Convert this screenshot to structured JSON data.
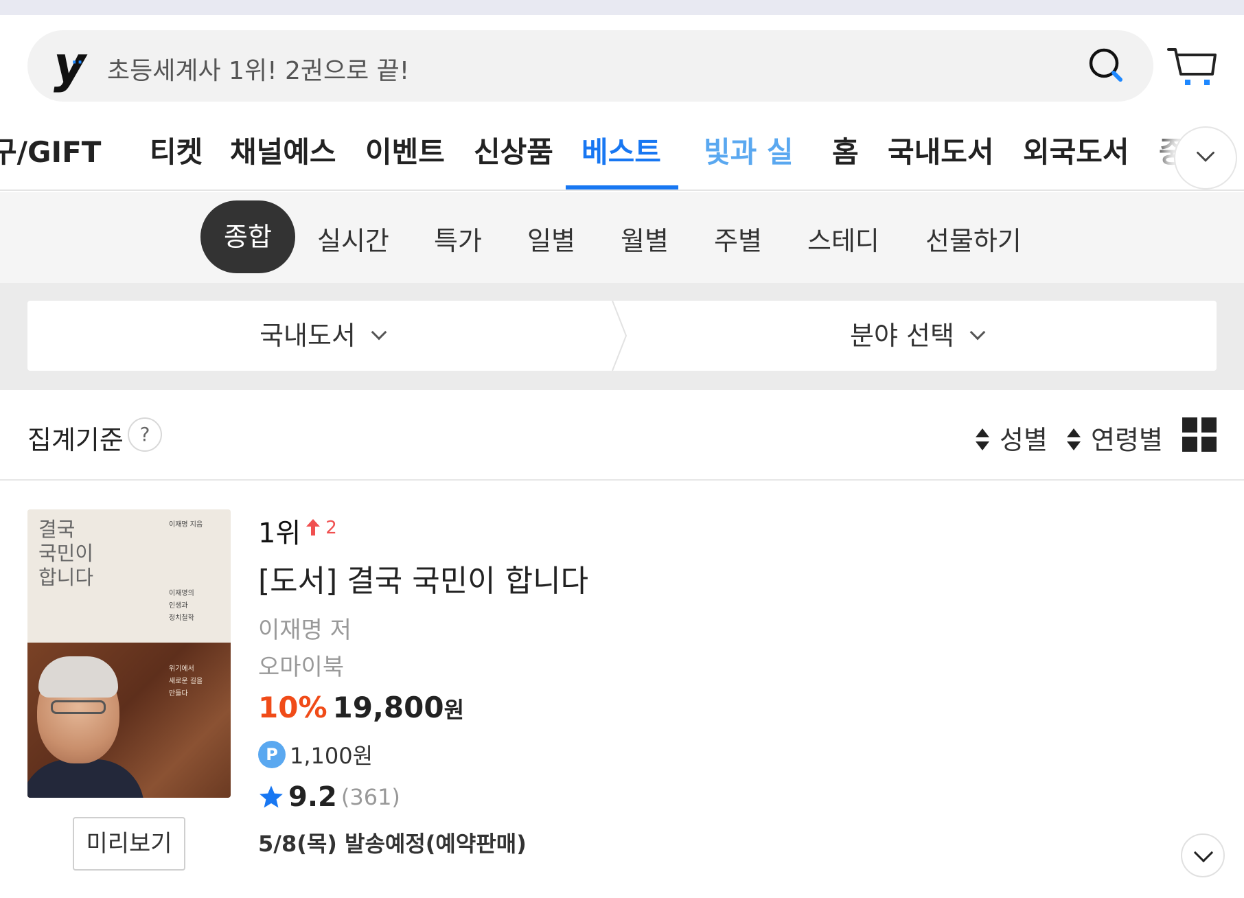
{
  "search": {
    "placeholder": "초등세계사 1위! 2권으로 끝!",
    "logo": "y",
    "search_icon": "search-icon",
    "cart_icon": "cart-icon"
  },
  "main_tabs": [
    "구/GIFT",
    "티켓",
    "채널예스",
    "이벤트",
    "신상품",
    "베스트",
    "빛과 실",
    "홈",
    "국내도서",
    "외국도서",
    "중"
  ],
  "main_tabs_active": "베스트",
  "sub_tabs": [
    "종합",
    "실시간",
    "특가",
    "일별",
    "월별",
    "주별",
    "스테디",
    "선물하기"
  ],
  "sub_tabs_active": "종합",
  "filter": {
    "category": "국내도서",
    "field": "분야 선택"
  },
  "aggregate": {
    "label": "집계기준",
    "help": "?",
    "sort_gender": "성별",
    "sort_age": "연령별",
    "view_icon": "grid-view-icon"
  },
  "product": {
    "rank": "1위",
    "rank_change": "2",
    "title": "[도서] 결국 국민이 합니다",
    "author": "이재명 저",
    "publisher": "오마이북",
    "discount": "10%",
    "price": "19,800",
    "price_unit": "원",
    "point_badge": "P",
    "point": "1,100원",
    "rating": "9.2",
    "review_count": "(361)",
    "shipping": "5/8(목) 발송예정(예약판매)",
    "preview_label": "미리보기",
    "cover": {
      "title": "결국\n국민이\n합니다",
      "author_line": "이재명 지음",
      "subtitle": "이재명의\n인생과\n정치철학",
      "tagline": "위기에서\n새로운 길을\n만들다"
    }
  },
  "colors": {
    "accent": "#1877f2",
    "discount": "#f04b18",
    "rank_up": "#f05050",
    "point": "#5aa8f0"
  }
}
